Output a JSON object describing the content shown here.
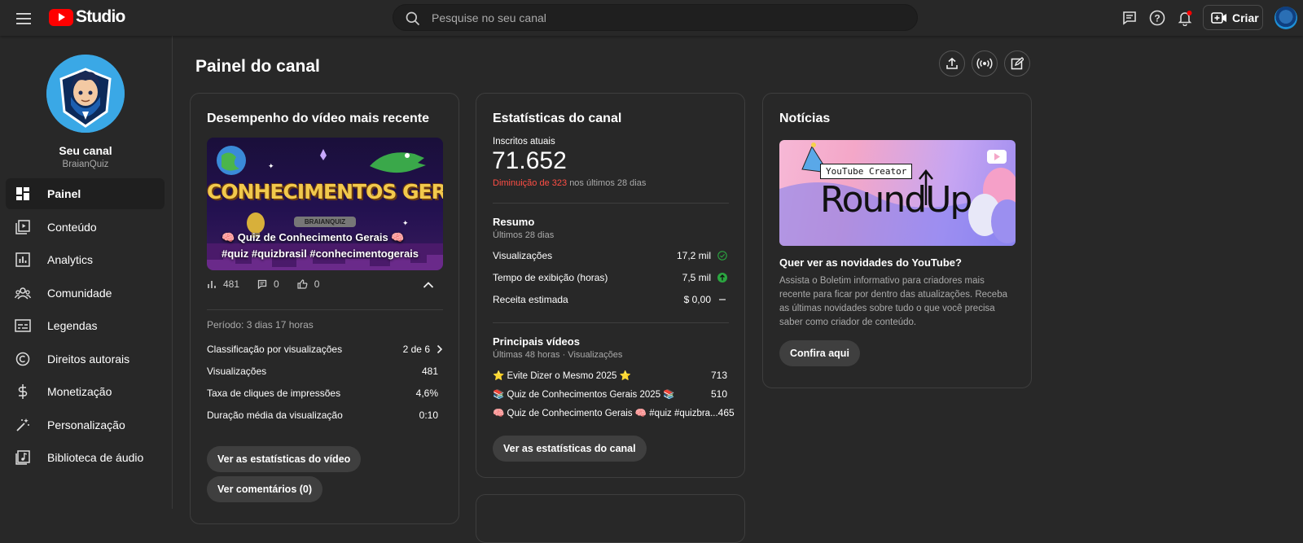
{
  "topbar": {
    "brand": "Studio",
    "search_placeholder": "Pesquise no seu canal",
    "create_label": "Criar",
    "icons": [
      "menu-icon",
      "captions-icon",
      "help-icon",
      "notifications-icon",
      "create-video-icon"
    ]
  },
  "sidebar": {
    "channel_name": "Seu canal",
    "channel_handle": "BraianQuiz",
    "items": [
      {
        "label": "Painel",
        "icon": "dashboard-icon",
        "active": true
      },
      {
        "label": "Conteúdo",
        "icon": "content-icon"
      },
      {
        "label": "Analytics",
        "icon": "analytics-icon"
      },
      {
        "label": "Comunidade",
        "icon": "community-icon"
      },
      {
        "label": "Legendas",
        "icon": "subtitles-icon"
      },
      {
        "label": "Direitos autorais",
        "icon": "copyright-icon"
      },
      {
        "label": "Monetização",
        "icon": "monetization-icon"
      },
      {
        "label": "Personalização",
        "icon": "customization-icon"
      },
      {
        "label": "Biblioteca de áudio",
        "icon": "audio-library-icon"
      }
    ]
  },
  "main": {
    "title": "Painel do canal",
    "actions": [
      "upload-icon",
      "live-icon",
      "create-post-icon"
    ]
  },
  "latest_video": {
    "title": "Desempenho do vídeo mais recente",
    "thumb_heading": "CONHECIMENTOS GERAIS",
    "thumb_badge": "BRAIANQUIZ",
    "video_title": "🧠 Quiz de Conhecimento Gerais 🧠 #quiz #quizbrasil #conhecimentogerais",
    "views": "481",
    "comments": "0",
    "likes": "0",
    "period": "Período: 3 dias 17 horas",
    "metrics": [
      {
        "label": "Classificação por visualizações",
        "value": "2 de 6"
      },
      {
        "label": "Visualizações",
        "value": "481"
      },
      {
        "label": "Taxa de cliques de impressões",
        "value": "4,6%"
      },
      {
        "label": "Duração média da visualização",
        "value": "0:10"
      }
    ],
    "btn_stats": "Ver as estatísticas do vídeo",
    "btn_comments": "Ver comentários (0)"
  },
  "channel_stats": {
    "title": "Estatísticas do canal",
    "subs_label": "Inscritos atuais",
    "subs_value": "71.652",
    "subs_change_red": "Diminuição de 323",
    "subs_change_rest": "nos últimos 28 dias",
    "summary_title": "Resumo",
    "summary_sub": "Últimos 28 dias",
    "summary": [
      {
        "label": "Visualizações",
        "value": "17,2 mil",
        "status": "check"
      },
      {
        "label": "Tempo de exibição (horas)",
        "value": "7,5 mil",
        "status": "up"
      },
      {
        "label": "Receita estimada",
        "value": "$ 0,00",
        "status": "dash"
      }
    ],
    "top_title": "Principais vídeos",
    "top_sub": "Últimas 48 horas · Visualizações",
    "top_videos": [
      {
        "title": "⭐ Evite Dizer o Mesmo 2025 ⭐",
        "views": "713"
      },
      {
        "title": "📚 Quiz de Conhecimentos Gerais 2025 📚",
        "views": "510"
      },
      {
        "title": "🧠 Quiz de Conhecimento Gerais 🧠 #quiz #quizbra...",
        "views": "465"
      }
    ],
    "btn_stats": "Ver as estatísticas do canal"
  },
  "news": {
    "title": "Notícias",
    "image_tag": "YouTube Creator",
    "image_heading": "RoundUp",
    "headline": "Quer ver as novidades do YouTube?",
    "body": "Assista o Boletim informativo para criadores mais recente para ficar por dentro das atualizações. Receba as últimas novidades sobre tudo o que você precisa saber como criador de conteúdo.",
    "btn": "Confira aqui"
  },
  "colors": {
    "background": "#282828",
    "brand_red": "#ff0000",
    "decrease": "#ff4e45",
    "up_green": "#2ba640"
  }
}
